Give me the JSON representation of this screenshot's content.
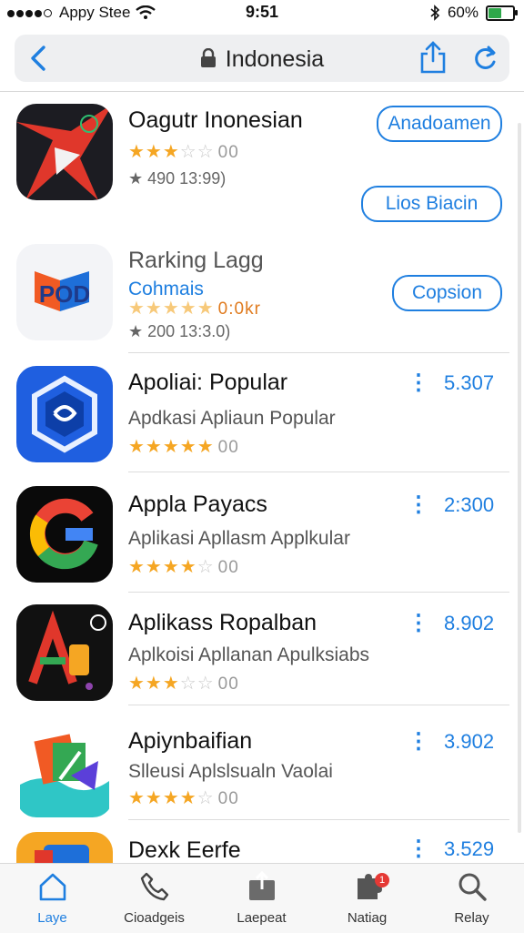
{
  "status_bar": {
    "carrier": "Appy Stee",
    "time": "9:51",
    "battery": "60%",
    "battery_level": 0.6
  },
  "navbar": {
    "title": "Indonesia"
  },
  "apps": [
    {
      "name": "Oagutr Inonesian",
      "stars": "★★★",
      "empty": "☆☆",
      "rating_count": "00",
      "meta": "★ 490 13:99)",
      "button": "Anadoamen",
      "button2": "Lios Biacin"
    },
    {
      "name": "Rarking Lagg",
      "sub": "Cohmais",
      "stars": "★★★★★",
      "rating_count": "0:0kr",
      "meta": "★ 200 13:3.0)",
      "button": "Copsion"
    },
    {
      "name": "Apoliai: Popular",
      "sub": "Apdkasi Apliaun Popular",
      "stars": "★★★★★",
      "rating_count": "00",
      "price": "5.307"
    },
    {
      "name": "Appla Payacs",
      "sub": "Aplikasi Apllasm Applkular",
      "stars": "★★★★",
      "empty": "☆",
      "rating_count": "00",
      "price": "2:300"
    },
    {
      "name": "Aplikass Ropalban",
      "sub": "Aplkoisi Apllanan Apulksiabs",
      "stars": "★★★",
      "empty": "☆☆",
      "rating_count": "00",
      "price": "8.902"
    },
    {
      "name": "Apiynbaifian",
      "sub": "Slleusi Aplslsualn Vaolai",
      "stars": "★★★★",
      "empty": "☆",
      "rating_count": "00",
      "price": "3.902"
    },
    {
      "name": "Dexk Eerfe",
      "price": "3.529"
    }
  ],
  "tabs": [
    {
      "label": "Laye"
    },
    {
      "label": "Cioadgeis"
    },
    {
      "label": "Laepeat"
    },
    {
      "label": "Natiag",
      "badge": "1"
    },
    {
      "label": "Relay"
    }
  ]
}
